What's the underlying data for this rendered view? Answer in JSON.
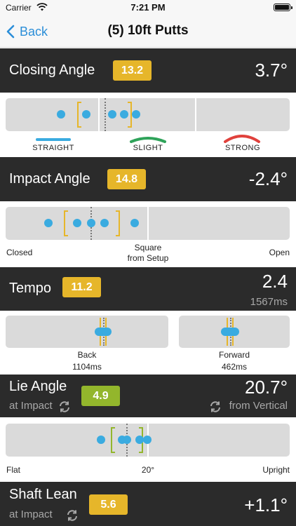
{
  "status_bar": {
    "carrier": "Carrier",
    "time": "7:21 PM"
  },
  "nav": {
    "back_label": "Back",
    "title": "(5) 10ft Putts"
  },
  "colors": {
    "accent": "#2b8ed8",
    "dot": "#3aabe0",
    "badge_yellow": "#e6b62a",
    "badge_green": "#93b62c",
    "header_bg": "#2b2b2b"
  },
  "closing_angle": {
    "label": "Closing Angle",
    "badge": "13.2",
    "value": "3.7°",
    "arc_labels": [
      "STRAIGHT",
      "SLIGHT",
      "STRONG"
    ],
    "arc_colors": [
      "#3aabe0",
      "#2fa35a",
      "#e0413c"
    ]
  },
  "impact_angle": {
    "label": "Impact Angle",
    "badge": "14.8",
    "value": "-2.4°",
    "left_label": "Closed",
    "center_label_1": "Square",
    "center_label_2": "from Setup",
    "right_label": "Open"
  },
  "tempo": {
    "label": "Tempo",
    "badge": "11.2",
    "value": "2.4",
    "sub_value": "1567ms",
    "back_label": "Back",
    "back_value": "1104ms",
    "forward_label": "Forward",
    "forward_value": "462ms"
  },
  "lie_angle": {
    "label": "Lie Angle",
    "sub_left": "at Impact",
    "badge": "4.9",
    "value": "20.7°",
    "sub_right": "from Vertical",
    "left_label": "Flat",
    "center_label": "20°",
    "right_label": "Upright"
  },
  "shaft_lean": {
    "label": "Shaft Lean",
    "sub_left": "at Impact",
    "badge": "5.6",
    "value": "+1.1°"
  }
}
